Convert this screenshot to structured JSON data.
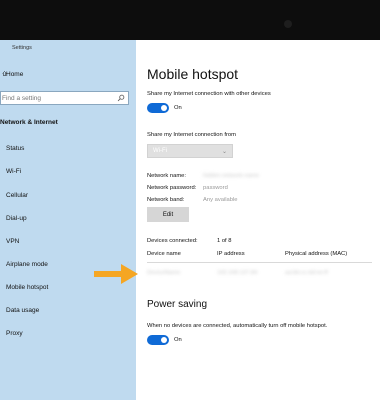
{
  "sidebar": {
    "title": "Settings",
    "home": "Home",
    "search_placeholder": "Find a setting",
    "section": "Network & Internet",
    "items": [
      "Status",
      "Wi-Fi",
      "Cellular",
      "Dial-up",
      "VPN",
      "Airplane mode",
      "Mobile hotspot",
      "Data usage",
      "Proxy"
    ]
  },
  "main": {
    "title": "Mobile hotspot",
    "share_label": "Share my Internet connection with other devices",
    "share_toggle": "On",
    "share_from_label": "Share my Internet connection from",
    "share_from_value": "Wi-Fi",
    "network_name_label": "Network name:",
    "network_name_value": "hidden-network-name",
    "network_password_label": "Network password:",
    "network_password_value": "password",
    "network_band_label": "Network band:",
    "network_band_value": "Any available",
    "edit_button": "Edit",
    "devices_connected_label": "Devices connected:",
    "devices_connected_value": "1 of 8",
    "table": {
      "headers": [
        "Device name",
        "IP address",
        "Physical address (MAC)"
      ],
      "row": [
        "DeviceName",
        "192.168.137.84",
        "aa:bb:cc:dd:ee:ff"
      ]
    },
    "power_saving_title": "Power saving",
    "power_saving_desc": "When no devices are connected, automatically turn off mobile hotspot.",
    "power_saving_toggle": "On"
  },
  "colors": {
    "accent": "#0f6ad6",
    "sidebar_bg": "#bfdaef",
    "arrow": "#f5a623"
  }
}
